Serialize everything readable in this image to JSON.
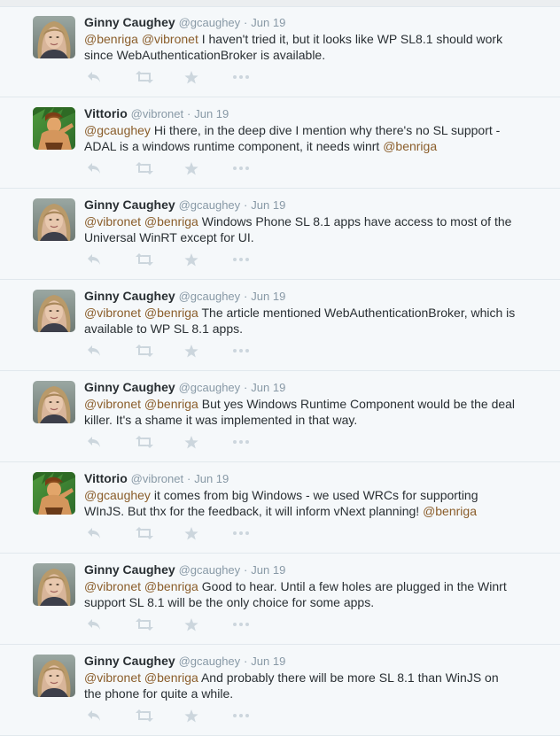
{
  "tweets": [
    {
      "author": "Ginny Caughey",
      "handle": "@gcaughey",
      "separator": "·",
      "time": "Jun 19",
      "avatar": "ginny",
      "segments": [
        {
          "text": "@benriga",
          "type": "mention"
        },
        {
          "text": " ",
          "type": "text"
        },
        {
          "text": "@vibronet",
          "type": "mention"
        },
        {
          "text": " I haven't tried it, but it looks like WP SL8.1 should work since WebAuthenticationBroker is available.",
          "type": "text"
        }
      ]
    },
    {
      "author": "Vittorio",
      "handle": "@vibronet",
      "separator": "·",
      "time": "Jun 19",
      "avatar": "vittorio",
      "segments": [
        {
          "text": "@gcaughey",
          "type": "mention"
        },
        {
          "text": " Hi there, in the deep dive I mention why there's no SL support - ADAL is a windows runtime component, it needs winrt ",
          "type": "text"
        },
        {
          "text": "@benriga",
          "type": "mention"
        }
      ]
    },
    {
      "author": "Ginny Caughey",
      "handle": "@gcaughey",
      "separator": "·",
      "time": "Jun 19",
      "avatar": "ginny",
      "segments": [
        {
          "text": "@vibronet",
          "type": "mention"
        },
        {
          "text": " ",
          "type": "text"
        },
        {
          "text": "@benriga",
          "type": "mention"
        },
        {
          "text": " Windows Phone SL 8.1 apps have access to most of the Universal WinRT except for UI.",
          "type": "text"
        }
      ]
    },
    {
      "author": "Ginny Caughey",
      "handle": "@gcaughey",
      "separator": "·",
      "time": "Jun 19",
      "avatar": "ginny",
      "segments": [
        {
          "text": "@vibronet",
          "type": "mention"
        },
        {
          "text": " ",
          "type": "text"
        },
        {
          "text": "@benriga",
          "type": "mention"
        },
        {
          "text": " The article mentioned WebAuthenticationBroker, which is available to WP SL 8.1 apps.",
          "type": "text"
        }
      ]
    },
    {
      "author": "Ginny Caughey",
      "handle": "@gcaughey",
      "separator": "·",
      "time": "Jun 19",
      "avatar": "ginny",
      "segments": [
        {
          "text": "@vibronet",
          "type": "mention"
        },
        {
          "text": " ",
          "type": "text"
        },
        {
          "text": "@benriga",
          "type": "mention"
        },
        {
          "text": " But yes Windows Runtime Component would be the deal killer. It's a shame it was implemented in that way.",
          "type": "text"
        }
      ]
    },
    {
      "author": "Vittorio",
      "handle": "@vibronet",
      "separator": "·",
      "time": "Jun 19",
      "avatar": "vittorio",
      "segments": [
        {
          "text": "@gcaughey",
          "type": "mention"
        },
        {
          "text": " it comes from big Windows - we used WRCs for supporting WInJS. But thx for the feedback, it will inform vNext planning! ",
          "type": "text"
        },
        {
          "text": "@benriga",
          "type": "mention"
        }
      ]
    },
    {
      "author": "Ginny Caughey",
      "handle": "@gcaughey",
      "separator": "·",
      "time": "Jun 19",
      "avatar": "ginny",
      "segments": [
        {
          "text": "@vibronet",
          "type": "mention"
        },
        {
          "text": " ",
          "type": "text"
        },
        {
          "text": "@benriga",
          "type": "mention"
        },
        {
          "text": " Good to hear. Until a few holes are plugged in the Winrt support SL 8.1 will be the only choice for some apps.",
          "type": "text"
        }
      ]
    },
    {
      "author": "Ginny Caughey",
      "handle": "@gcaughey",
      "separator": "·",
      "time": "Jun 19",
      "avatar": "ginny",
      "segments": [
        {
          "text": "@vibronet",
          "type": "mention"
        },
        {
          "text": " ",
          "type": "text"
        },
        {
          "text": "@benriga",
          "type": "mention"
        },
        {
          "text": " And probably there will be more SL 8.1 than WinJS on the phone for quite a while.",
          "type": "text"
        }
      ]
    }
  ],
  "actions": [
    "reply-icon",
    "retweet-icon",
    "favorite-icon",
    "more-icon"
  ],
  "colors": {
    "background": "#f5f8fa",
    "text": "#292f33",
    "muted": "#8899a6",
    "mention": "#8a5d2a",
    "action_icon": "#ccd6dd",
    "divider": "#e1e8ed"
  }
}
